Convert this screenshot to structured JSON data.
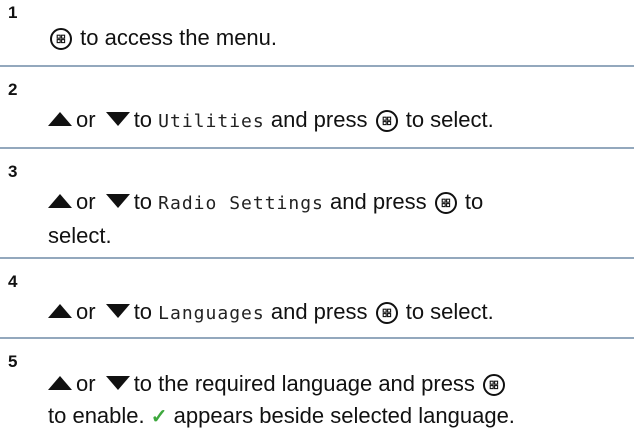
{
  "steps": [
    {
      "number": "1",
      "text_after_menu": "to access the menu."
    },
    {
      "number": "2",
      "or_text": "or",
      "to_text": "to",
      "menu_name": "Utilities",
      "and_press": "and press",
      "to_select": "to select."
    },
    {
      "number": "3",
      "or_text": "or",
      "to_text": "to",
      "menu_name": "Radio Settings",
      "and_press": "and press",
      "to_text_end": "to",
      "select_text": "select."
    },
    {
      "number": "4",
      "or_text": "or",
      "to_text": "to",
      "menu_name": "Languages",
      "and_press": "and press",
      "to_select": "to select."
    },
    {
      "number": "5",
      "or_text": "or",
      "to_text": "to the required language and press",
      "to_enable": "to enable.",
      "appears": "appears beside selected language."
    }
  ],
  "icons": {
    "menu_ok": "menu-ok-button-icon",
    "up": "up-arrow-icon",
    "down": "down-arrow-icon",
    "check": "check-mark-icon"
  },
  "colors": {
    "divider": "#93a8bd",
    "check": "#3ea83e"
  }
}
